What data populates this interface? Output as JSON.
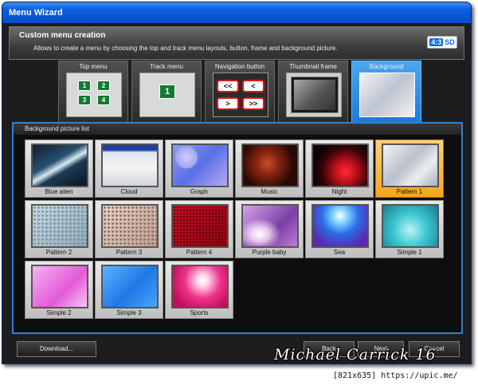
{
  "window": {
    "title": "Menu Wizard"
  },
  "header": {
    "title": "Custom menu creation",
    "description": "Allows to create a menu by choosing the top and track menu layouts, button, frame and background picture.",
    "badge_ratio": "4:3",
    "badge_format": "SD"
  },
  "tabs": [
    {
      "label": "Top menu",
      "icon": "top-menu-layout"
    },
    {
      "label": "Track menu",
      "icon": "track-menu-layout"
    },
    {
      "label": "Navigation button",
      "icon": "navigation-buttons"
    },
    {
      "label": "Thumbnail frame",
      "icon": "thumbnail-frame"
    },
    {
      "label": "Background",
      "icon": "background-picture",
      "active": true
    }
  ],
  "top_menu_thumb": {
    "numbers": [
      "1",
      "2",
      "3",
      "4"
    ]
  },
  "track_menu_thumb": {
    "number": "1"
  },
  "nav_thumb": {
    "buttons": [
      "<<",
      "<",
      ">",
      ">>"
    ]
  },
  "panel": {
    "title": "Background picture list"
  },
  "backgrounds": [
    {
      "label": "Blue alien"
    },
    {
      "label": "Cloud"
    },
    {
      "label": "Graph"
    },
    {
      "label": "Music"
    },
    {
      "label": "Night"
    },
    {
      "label": "Pattern 1",
      "selected": true
    },
    {
      "label": "Pattern 2"
    },
    {
      "label": "Pattern 3"
    },
    {
      "label": "Pattern 4"
    },
    {
      "label": "Purple baby"
    },
    {
      "label": "Sea"
    },
    {
      "label": "Simple 1"
    },
    {
      "label": "Simple 2"
    },
    {
      "label": "Simple 3"
    },
    {
      "label": "Sports"
    }
  ],
  "footer": {
    "download": "Download...",
    "back": "Back",
    "next": "Next",
    "cancel": "Cancel"
  },
  "overlay": {
    "signature": "Michael Carrick 16",
    "watermark": "[821x635] https://upic.me/"
  }
}
